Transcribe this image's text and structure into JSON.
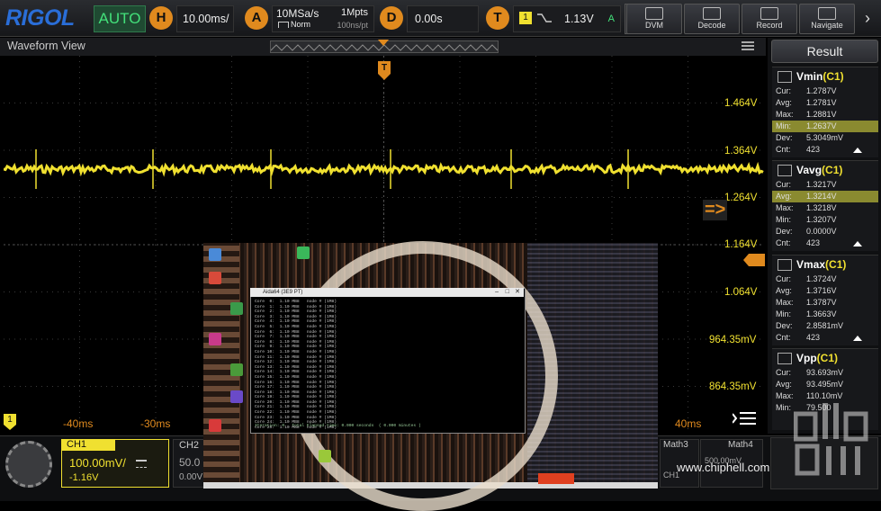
{
  "topbar": {
    "logo": "RIGOL",
    "mode": "AUTO",
    "horizontal": {
      "badge": "H",
      "value": "10.00ms/"
    },
    "acquire": {
      "badge": "A",
      "rate": "10MSa/s",
      "depth": "1Mpts",
      "mode": "Norm",
      "per_point": "100ns/pt"
    },
    "delay": {
      "badge": "D",
      "value": "0.00s"
    },
    "trigger": {
      "badge": "T",
      "channel": "1",
      "level": "1.13V",
      "status": "A"
    },
    "nav_buttons": [
      {
        "label": "DVM",
        "icon": "meter-icon"
      },
      {
        "label": "Decode",
        "icon": "decode-icon"
      },
      {
        "label": "Record",
        "icon": "record-icon"
      },
      {
        "label": "Navigate",
        "icon": "navigate-icon"
      }
    ]
  },
  "waveform": {
    "title": "Waveform View",
    "trigger_marker": "T",
    "y_labels": [
      "1.464V",
      "1.364V",
      "1.264V",
      "1.164V",
      "1.064V",
      "964.35mV",
      "864.35mV"
    ],
    "x_labels": [
      "-40ms",
      "-30ms",
      "40ms"
    ],
    "ch1_marker": "1",
    "arrow_overlay": "=>"
  },
  "result": {
    "title": "Result",
    "cards": [
      {
        "name": "Vmin",
        "channel": "(C1)",
        "rows": [
          [
            "Cur:",
            "1.2787V"
          ],
          [
            "Avg:",
            "1.2781V"
          ],
          [
            "Max:",
            "1.2881V"
          ],
          [
            "Min:",
            "1.2637V"
          ],
          [
            "Dev:",
            "5.3049mV"
          ],
          [
            "Cnt:",
            "423"
          ]
        ],
        "highlight": 3
      },
      {
        "name": "Vavg",
        "channel": "(C1)",
        "rows": [
          [
            "Cur:",
            "1.3217V"
          ],
          [
            "Avg:",
            "1.3214V"
          ],
          [
            "Max:",
            "1.3218V"
          ],
          [
            "Min:",
            "1.3207V"
          ],
          [
            "Dev:",
            "0.0000V"
          ],
          [
            "Cnt:",
            "423"
          ]
        ],
        "highlight": 1
      },
      {
        "name": "Vmax",
        "channel": "(C1)",
        "rows": [
          [
            "Cur:",
            "1.3724V"
          ],
          [
            "Avg:",
            "1.3716V"
          ],
          [
            "Max:",
            "1.3787V"
          ],
          [
            "Min:",
            "1.3663V"
          ],
          [
            "Dev:",
            "2.8581mV"
          ],
          [
            "Cnt:",
            "423"
          ]
        ],
        "highlight": -1
      },
      {
        "name": "Vpp",
        "channel": "(C1)",
        "rows": [
          [
            "Cur:",
            "93.693mV"
          ],
          [
            "Avg:",
            "93.495mV"
          ],
          [
            "Max:",
            "110.10mV"
          ],
          [
            "Min:",
            "79.500"
          ]
        ],
        "highlight": -1
      }
    ]
  },
  "bottom": {
    "ch1": {
      "label": "CH1",
      "scale": "100.00mV/",
      "offset": "-1.16V",
      "coupling": "DC"
    },
    "ch2": {
      "label": "CH2",
      "scale": "50.0",
      "offset": "0.00V"
    },
    "math3": "Math3",
    "math4": "Math4",
    "math_value": "500.00mV",
    "math_ch": "CH1",
    "watermark": "www.chiphell.com"
  },
  "desktop": {
    "cmd_title": "Aida64 (3E9 PT)",
    "cmd_lines": [
      "Core  0:  1.10 MB8   node # (1M8)",
      "Core  1:  1.10 MB8   node # (1M8)",
      "Core  2:  1.10 MB8   node # (1M8)",
      "Core  3:  1.10 MB8   node # (1M8)",
      "Core  4:  1.10 MB8   node # (1M8)",
      "Core  5:  1.10 MB8   node # (1M8)",
      "Core  6:  1.10 MB8   node # (1M8)",
      "Core  7:  1.10 MB8   node # (1M8)",
      "Core  8:  1.10 MB8   node # (1M8)",
      "Core  9:  1.10 MB8   node # (1M8)",
      "Core 10:  1.10 MB8   node # (1M8)",
      "Core 11:  1.10 MB8   node # (1M8)",
      "Core 12:  1.10 MB8   node # (1M8)",
      "Core 13:  1.10 MB8   node # (1M8)",
      "Core 14:  1.10 MB8   node # (1M8)",
      "Core 15:  1.10 MB8   node # (1M8)",
      "Core 16:  1.10 MB8   node # (1M8)",
      "Core 17:  1.10 MB8   node # (1M8)",
      "Core 18:  1.10 MB8   node # (1M8)",
      "Core 19:  1.10 MB8   node # (1M8)",
      "Core 20:  1.10 MB8   node # (1M8)",
      "Core 21:  1.10 MB8   node # (1M8)",
      "Core 22:  1.10 MB8   node # (1M8)",
      "Core 23:  1.10 MB8   node # (1M8)",
      "Core 24:  1.10 MB8   node # (1M8)",
      "Core 25:  1.10 MB8   node # (1M8)"
    ],
    "cmd_footer": "Iteration: 0   Total Elapsed time: 0.000 seconds  ( 0.000 minutes )"
  },
  "colors": {
    "ch1": "#f0e030",
    "accent": "#e08a1e",
    "brand": "#2a6ed8",
    "auto": "#43e07a"
  }
}
